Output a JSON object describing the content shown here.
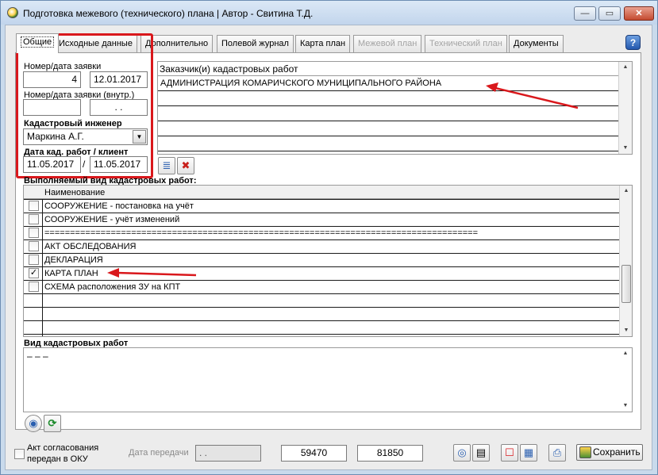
{
  "window": {
    "title": "Подготовка межевого (технического) плана | Автор - Свитина Т.Д.",
    "controls": {
      "minimize": "—",
      "maximize": "▭",
      "close": "✕"
    }
  },
  "tabs": [
    {
      "label": "Общие",
      "active": true,
      "enabled": true
    },
    {
      "label": "Исходные данные",
      "enabled": true
    },
    {
      "label": "Дополнительно",
      "enabled": true
    },
    {
      "label": "Полевой журнал",
      "enabled": true
    },
    {
      "label": "Карта план",
      "enabled": true
    },
    {
      "label": "Межевой план",
      "enabled": false
    },
    {
      "label": "Технический план",
      "enabled": false
    },
    {
      "label": "Документы",
      "enabled": true
    }
  ],
  "help_label": "?",
  "request": {
    "label": "Номер/дата заявки",
    "number": "4",
    "date": "12.01.2017",
    "internal_label": "Номер/дата заявки (внутр.)",
    "internal_number": "",
    "internal_date": ". ."
  },
  "engineer": {
    "label": "Кадастровый инженер",
    "value": "Маркина А.Г."
  },
  "work_dates": {
    "label": "Дата кад. работ / клиент",
    "work_date": "11.05.2017",
    "separator": "/",
    "client_date": "11.05.2017"
  },
  "customers": {
    "header": "Заказчик(и) кадастровых работ",
    "rows": [
      "АДМИНИСТРАЦИЯ КОМАРИЧСКОГО МУНИЦИПАЛЬНОГО РАЙОНА",
      "",
      "",
      "",
      ""
    ]
  },
  "works": {
    "label": "Выполняемый вид кадастровых работ:",
    "column": "Наименование",
    "rows": [
      {
        "name": "СООРУЖЕНИЕ - постановка на учёт",
        "checked": false
      },
      {
        "name": "СООРУЖЕНИЕ - учёт изменений",
        "checked": false
      },
      {
        "name": "=====================================================================================",
        "checked": false
      },
      {
        "name": "АКТ ОБСЛЕДОВАНИЯ",
        "checked": false
      },
      {
        "name": "ДЕКЛАРАЦИЯ",
        "checked": false
      },
      {
        "name": "КАРТА ПЛАН",
        "checked": true
      },
      {
        "name": "СХЕМА расположения ЗУ на КПТ",
        "checked": false
      }
    ]
  },
  "work_kind": {
    "label": "Вид кадастровых работ",
    "text": "– – –"
  },
  "footer": {
    "act_label_1": "Акт согласования",
    "act_label_2": "передан в ОКУ",
    "transfer_label": "Дата передачи",
    "transfer_date": ". .",
    "num1": "59470",
    "num2": "81850",
    "save_label": "Сохранить"
  },
  "icons": {
    "list": "≣",
    "delete": "✖",
    "disk": "◉",
    "refresh": "⟳",
    "target": "◎",
    "document": "▤",
    "frame": "☐",
    "report": "▦",
    "printer": "⎙"
  },
  "colors": {
    "highlight": "#d9181c",
    "selection_arrow": "#d9181c",
    "disabled_text": "#a3a3a3"
  }
}
